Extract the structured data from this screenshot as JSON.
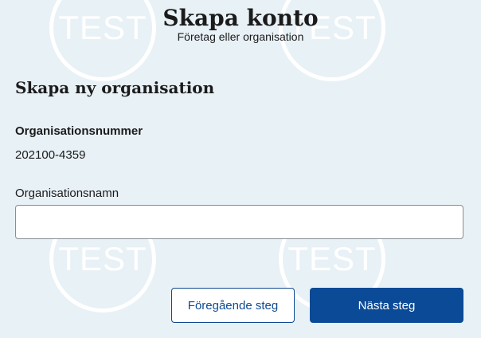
{
  "watermark": {
    "text": "TEST"
  },
  "header": {
    "title": "Skapa konto",
    "subtitle": "Företag eller organisation"
  },
  "form": {
    "section_title": "Skapa ny organisation",
    "org_number": {
      "label": "Organisationsnummer",
      "value": "202100-4359"
    },
    "org_name": {
      "label": "Organisationsnamn",
      "value": "",
      "placeholder": ""
    }
  },
  "actions": {
    "previous_label": "Föregående steg",
    "next_label": "Nästa steg"
  },
  "colors": {
    "background": "#e8f1f6",
    "primary": "#0b4a97",
    "text": "#1b1b1b"
  }
}
